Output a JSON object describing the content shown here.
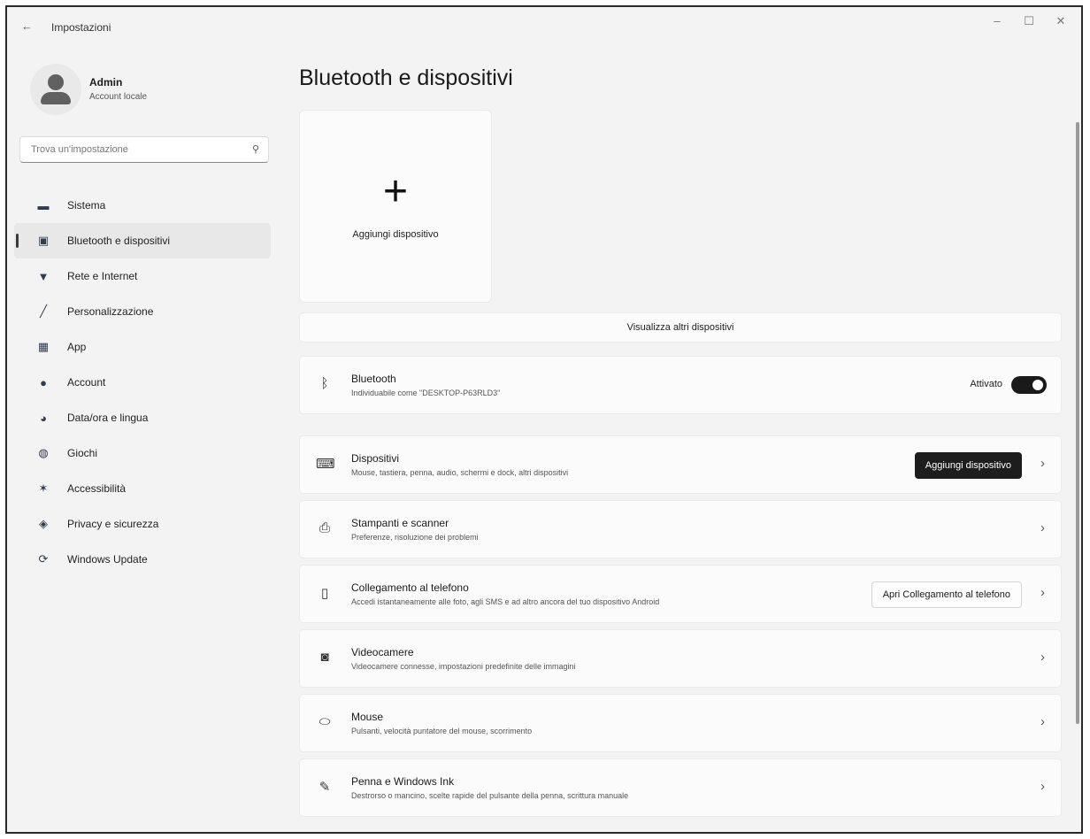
{
  "window": {
    "back_icon": "arrow-left-icon",
    "title": "Impostazioni",
    "controls": [
      "–",
      "☐",
      "✕"
    ]
  },
  "user": {
    "name": "Admin",
    "type": "Account locale"
  },
  "search": {
    "placeholder": "Trova un'impostazione",
    "icon": "search-icon"
  },
  "nav": [
    {
      "label": "Sistema",
      "icon": "monitor-icon",
      "glyph": "▬",
      "active": false
    },
    {
      "label": "Bluetooth e dispositivi",
      "icon": "bluetooth-devices-icon",
      "glyph": "▣",
      "active": true
    },
    {
      "label": "Rete e Internet",
      "icon": "wifi-icon",
      "glyph": "▼",
      "active": false
    },
    {
      "label": "Personalizzazione",
      "icon": "brush-icon",
      "glyph": "╱",
      "active": false
    },
    {
      "label": "App",
      "icon": "apps-icon",
      "glyph": "▦",
      "active": false
    },
    {
      "label": "Account",
      "icon": "person-icon",
      "glyph": "●",
      "active": false
    },
    {
      "label": "Data/ora e lingua",
      "icon": "globe-clock-icon",
      "glyph": "◕",
      "active": false
    },
    {
      "label": "Giochi",
      "icon": "gamepad-icon",
      "glyph": "◍",
      "active": false
    },
    {
      "label": "Accessibilità",
      "icon": "accessibility-icon",
      "glyph": "✶",
      "active": false
    },
    {
      "label": "Privacy e sicurezza",
      "icon": "shield-icon",
      "glyph": "◈",
      "active": false
    },
    {
      "label": "Windows Update",
      "icon": "update-icon",
      "glyph": "⟳",
      "active": false
    }
  ],
  "main": {
    "title": "Bluetooth e dispositivi",
    "add_tile": {
      "plus": "+",
      "label": "Aggiungi dispositivo"
    },
    "view_more": "Visualizza altri dispositivi",
    "bluetooth": {
      "icon": "bluetooth-icon",
      "glyph": "ᛒ",
      "title": "Bluetooth",
      "subtitle": "Individuabile come \"DESKTOP-P63RLD3\"",
      "toggle_label": "Attivato",
      "toggle_on": true
    },
    "cards": [
      {
        "icon": "devices-icon",
        "glyph": "⌨",
        "title": "Dispositivi",
        "subtitle": "Mouse, tastiera, penna, audio, schermi e dock, altri dispositivi",
        "button": "Aggiungi dispositivo",
        "button_style": "dark"
      },
      {
        "icon": "printer-icon",
        "glyph": "⎙",
        "title": "Stampanti e scanner",
        "subtitle": "Preferenze, risoluzione dei problemi"
      },
      {
        "icon": "phone-icon",
        "glyph": "▯",
        "title": "Collegamento al telefono",
        "subtitle": "Accedi istantaneamente alle foto, agli SMS e ad altro ancora del tuo dispositivo Android",
        "button": "Apri Collegamento al telefono",
        "button_style": "light"
      },
      {
        "icon": "camera-icon",
        "glyph": "◙",
        "title": "Videocamere",
        "subtitle": "Videocamere connesse, impostazioni predefinite delle immagini"
      },
      {
        "icon": "mouse-icon",
        "glyph": "⬭",
        "title": "Mouse",
        "subtitle": "Pulsanti, velocità puntatore del mouse, scorrimento"
      },
      {
        "icon": "pen-icon",
        "glyph": "✎",
        "title": "Penna e Windows Ink",
        "subtitle": "Destrorso o mancino, scelte rapide del pulsante della penna, scrittura manuale"
      }
    ],
    "chevron": "›"
  }
}
